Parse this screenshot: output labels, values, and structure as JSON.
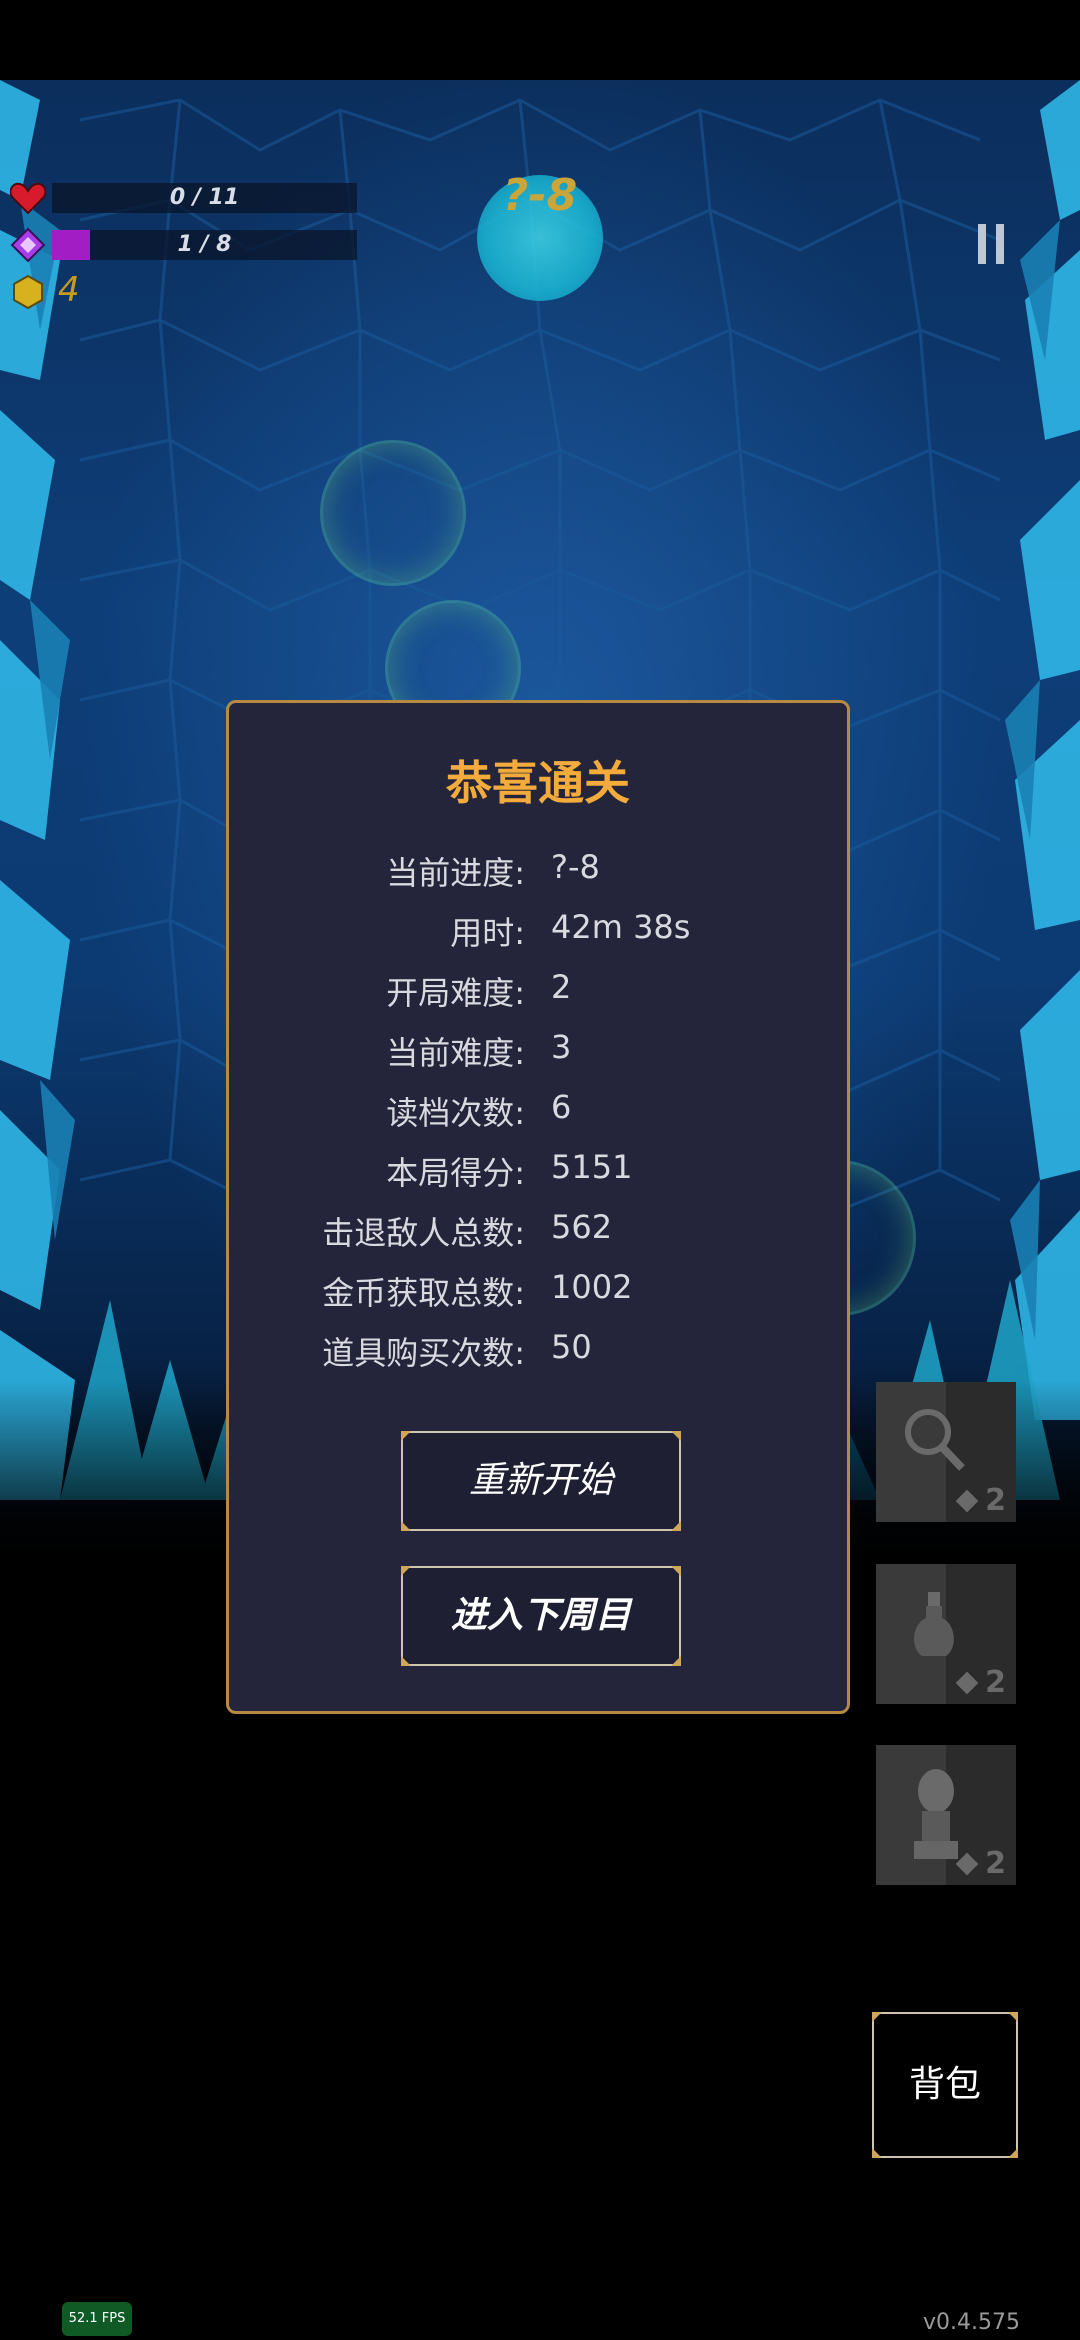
{
  "hud": {
    "health_text": "0 / 11",
    "health_fraction": 0,
    "mana_text": "1 / 8",
    "mana_fraction": 0.125,
    "coins": "4",
    "level": "?-8"
  },
  "result_panel": {
    "title": "恭喜通关",
    "stats": [
      {
        "label": "当前进度:",
        "value": "?-8"
      },
      {
        "label": "用时:",
        "value": "42m 38s"
      },
      {
        "label": "开局难度:",
        "value": "2"
      },
      {
        "label": "当前难度:",
        "value": "3"
      },
      {
        "label": "读档次数:",
        "value": "6"
      },
      {
        "label": "本局得分:",
        "value": "5151"
      },
      {
        "label": "击退敌人总数:",
        "value": "562"
      },
      {
        "label": "金币获取总数:",
        "value": "1002"
      },
      {
        "label": "道具购买次数:",
        "value": "50"
      }
    ],
    "restart_label": "重新开始",
    "next_cycle_label": "进入下周目"
  },
  "item_slots": [
    {
      "icon": "magnifier-icon",
      "cost": "2"
    },
    {
      "icon": "potion-icon",
      "cost": "2"
    },
    {
      "icon": "statue-icon",
      "cost": "2"
    }
  ],
  "bag_label": "背包",
  "fps": "52.1 FPS",
  "version": "v0.4.575",
  "colors": {
    "accent_gold": "#f3ab3c",
    "panel_border": "#b78a43",
    "mana_bar": "#a21ec4",
    "coin": "#c99b1d"
  }
}
